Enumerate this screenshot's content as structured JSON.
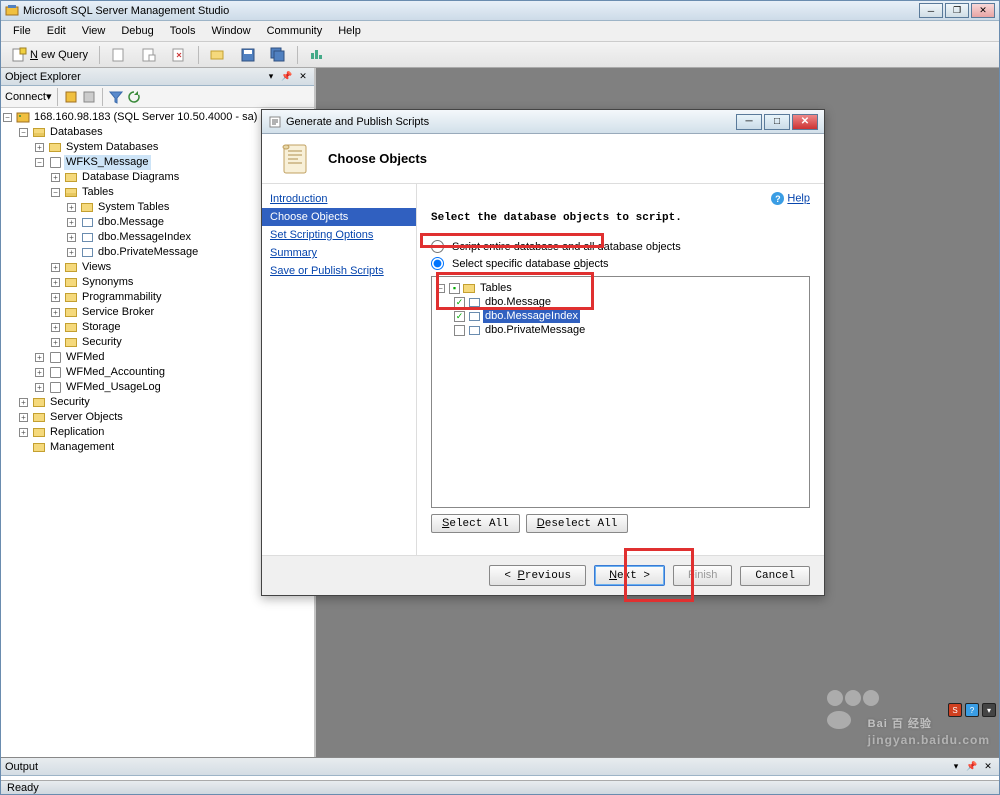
{
  "app": {
    "title": "Microsoft SQL Server Management Studio",
    "status": "Ready"
  },
  "menubar": [
    "File",
    "Edit",
    "View",
    "Debug",
    "Tools",
    "Window",
    "Community",
    "Help"
  ],
  "toolbar": {
    "new_query": "New Query"
  },
  "object_explorer": {
    "title": "Object Explorer",
    "connect_label": "Connect",
    "root": "168.160.98.183 (SQL Server 10.50.4000 - sa)",
    "databases": "Databases",
    "system_db": "System Databases",
    "db_name": "WFKS_Message",
    "diagrams": "Database Diagrams",
    "tables": "Tables",
    "system_tables": "System Tables",
    "tbl1": "dbo.Message",
    "tbl2": "dbo.MessageIndex",
    "tbl3": "dbo.PrivateMessage",
    "views": "Views",
    "synonyms": "Synonyms",
    "programmability": "Programmability",
    "service_broker": "Service Broker",
    "storage": "Storage",
    "security_node": "Security",
    "wfmed": "WFMed",
    "wfmed_acc": "WFMed_Accounting",
    "wfmed_log": "WFMed_UsageLog",
    "security": "Security",
    "server_objects": "Server Objects",
    "replication": "Replication",
    "management": "Management"
  },
  "output": {
    "title": "Output"
  },
  "dialog": {
    "title": "Generate and Publish Scripts",
    "header": "Choose Objects",
    "help": "Help",
    "nav": {
      "intro": "Introduction",
      "choose": "Choose Objects",
      "scripting": "Set Scripting Options",
      "summary": "Summary",
      "save": "Save or Publish Scripts"
    },
    "instruction": "Select the database objects to script.",
    "opt_entire": "Script entire database and all database objects",
    "opt_specific": "Select specific database objects",
    "tree": {
      "tables": "Tables",
      "t1": "dbo.Message",
      "t2": "dbo.MessageIndex",
      "t3": "dbo.PrivateMessage"
    },
    "select_all": "Select All",
    "deselect_all": "Deselect All",
    "prev": "< Previous",
    "next": "Next >",
    "finish": "Finish",
    "cancel": "Cancel"
  },
  "watermark": {
    "main": "Bai 百 经验",
    "sub": "jingyan.baidu.com"
  }
}
